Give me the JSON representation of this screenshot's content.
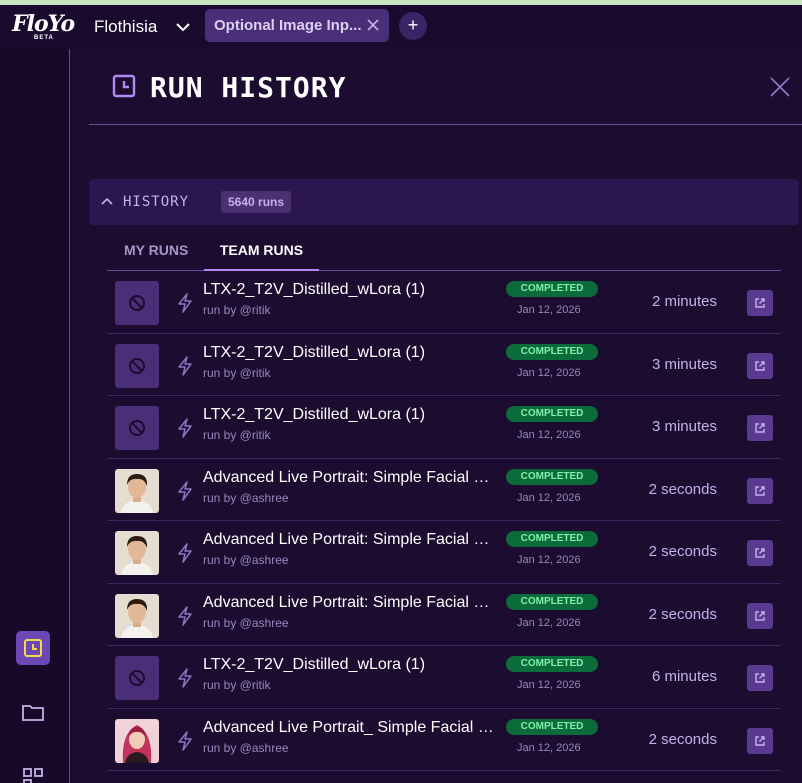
{
  "app": {
    "logo_text": "FloYo",
    "logo_badge": "BETA",
    "project_name": "Flothisia",
    "tab_label": "Optional Image Inp...",
    "tab_add": "+"
  },
  "panel": {
    "title": "RUN HISTORY",
    "history_label": "HISTORY",
    "history_count": "5640 runs",
    "tabs": [
      {
        "label": "MY RUNS",
        "active": false
      },
      {
        "label": "TEAM RUNS",
        "active": true
      }
    ]
  },
  "colors": {
    "accent": "#b08af0",
    "status_bg": "#0b6b3a",
    "status_text": "#7ff0a8",
    "active_side": "#6d48b5"
  },
  "runs": [
    {
      "title": "LTX-2_T2V_Distilled_wLora (1)",
      "by": "run by @ritik",
      "status": "COMPLETED",
      "date": "Jan 12, 2026",
      "duration": "2 minutes",
      "thumb": "blocked"
    },
    {
      "title": "LTX-2_T2V_Distilled_wLora (1)",
      "by": "run by @ritik",
      "status": "COMPLETED",
      "date": "Jan 12, 2026",
      "duration": "3 minutes",
      "thumb": "blocked"
    },
    {
      "title": "LTX-2_T2V_Distilled_wLora (1)",
      "by": "run by @ritik",
      "status": "COMPLETED",
      "date": "Jan 12, 2026",
      "duration": "3 minutes",
      "thumb": "blocked"
    },
    {
      "title": "Advanced Live Portrait: Simple Facial Expression",
      "by": "run by @ashree",
      "status": "COMPLETED",
      "date": "Jan 12, 2026",
      "duration": "2 seconds",
      "thumb": "portrait-man"
    },
    {
      "title": "Advanced Live Portrait: Simple Facial Expression",
      "by": "run by @ashree",
      "status": "COMPLETED",
      "date": "Jan 12, 2026",
      "duration": "2 seconds",
      "thumb": "portrait-man"
    },
    {
      "title": "Advanced Live Portrait: Simple Facial Expression",
      "by": "run by @ashree",
      "status": "COMPLETED",
      "date": "Jan 12, 2026",
      "duration": "2 seconds",
      "thumb": "portrait-man"
    },
    {
      "title": "LTX-2_T2V_Distilled_wLora (1)",
      "by": "run by @ritik",
      "status": "COMPLETED",
      "date": "Jan 12, 2026",
      "duration": "6 minutes",
      "thumb": "blocked"
    },
    {
      "title": "Advanced Live Portrait_ Simple Facial Expression",
      "by": "run by @ashree",
      "status": "COMPLETED",
      "date": "Jan 12, 2026",
      "duration": "2 seconds",
      "thumb": "portrait-woman"
    }
  ],
  "icons": {
    "history": "clock-icon",
    "folder": "folder-icon",
    "workflow": "workflow-icon",
    "bolt": "bolt-icon",
    "blocked": "blocked-icon",
    "open": "open-external-icon"
  }
}
